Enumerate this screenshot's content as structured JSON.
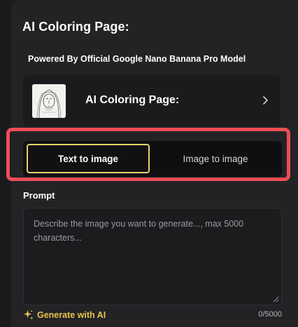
{
  "panel": {
    "title": "AI Coloring Page:",
    "powered_by": "Powered By Official Google Nano Banana Pro Model"
  },
  "model_card": {
    "label": "AI Coloring Page:",
    "thumbnail_icon": "line-art-portrait",
    "action_icon": "chevron-right-icon"
  },
  "mode_toggle": {
    "options": [
      {
        "label": "Text to image",
        "active": true
      },
      {
        "label": "Image to image",
        "active": false
      }
    ],
    "highlight_color": "#ef4d54",
    "active_border_color": "#e5d36a"
  },
  "prompt": {
    "label": "Prompt",
    "placeholder": "Describe the image you want to generate..., max 5000 characters...",
    "value": "",
    "char_count": "0/5000"
  },
  "generate_with_ai": {
    "label": "Generate with AI",
    "icon": "sparkle-icon",
    "color": "#e8c44a"
  }
}
